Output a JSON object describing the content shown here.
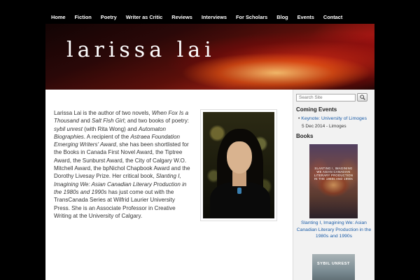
{
  "nav": [
    "Home",
    "Fiction",
    "Poetry",
    "Writer as Critic",
    "Reviews",
    "Interviews",
    "For Scholars",
    "Blog",
    "Events",
    "Contact"
  ],
  "site_title": "larissa lai",
  "intro": {
    "p1": "Larissa Lai is the author of two novels, ",
    "t1": "When Fox Is a Thousand",
    "p2": " and ",
    "t2": "Salt Fish Girl",
    "p3": "; and two books of poetry: ",
    "t3": "sybil unrest",
    "p4": " (with Rita Wong) and ",
    "t4": "Automaton Biographies",
    "p5": ". A recipient of the ",
    "t5": "Astraea Foundation Emerging Writers' Award",
    "p6": ", she has been shortlisted for the Books in Canada First Novel Award, the Tiptree Award, the Sunburst Award, the City of Calgary W.O. Mitchell Award, the bpNichol Chapbook Award and the Dorothy Livesay Prize. Her critical book, ",
    "t6": "Slanting I, Imagining We: Asian Canadian Literary Production in the 1980s and 1990s",
    "p7": " has just come out with the TransCanada Series at Wilfrid Laurier University Press. She is an Associate Professor in Creative Writing at the University of Calgary."
  },
  "sidebar": {
    "search_placeholder": "Search Site",
    "coming_events_heading": "Coming Events",
    "event_link": "Keynote: University of Limoges",
    "event_date": "5 Dec 2014 - Limoges",
    "books_heading": "Books",
    "book1_cover_text": "SLANTING I, IMAGINING WE ASIAN CANADIAN LITERARY PRODUCTION IN THE 1980s AND 1990s",
    "book1_caption": "Slanting I, Imagining We: Asian Canadian Literary Production in the 1980s and 1990s",
    "book2_cover_text": "SYBIL UNREST"
  },
  "colors": {
    "link": "#1a5ca8",
    "nav_bg": "#000000",
    "content_bg": "#ffffff",
    "sidebar_bg": "#f2f2f2"
  },
  "icons": {
    "search_button": "magnifier-icon"
  }
}
